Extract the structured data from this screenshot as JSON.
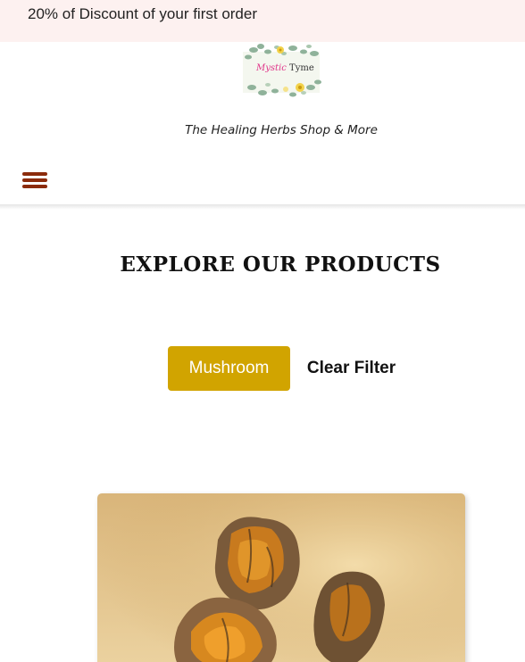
{
  "promo": {
    "text": "20% of Discount of your first order"
  },
  "brand": {
    "logo_word_1": "Mystic",
    "logo_word_2": "Tyme",
    "tagline": "The Healing Herbs Shop & More"
  },
  "nav": {
    "menu_icon": "hamburger-menu-icon"
  },
  "section": {
    "title": "EXPLORE OUR PRODUCTS"
  },
  "filters": {
    "active_label": "Mushroom",
    "clear_label": "Clear Filter"
  },
  "colors": {
    "promo_bg": "#fdf1f0",
    "accent": "#d1a400",
    "menu_icon": "#8b2b0c",
    "logo_pink": "#e0368a"
  }
}
